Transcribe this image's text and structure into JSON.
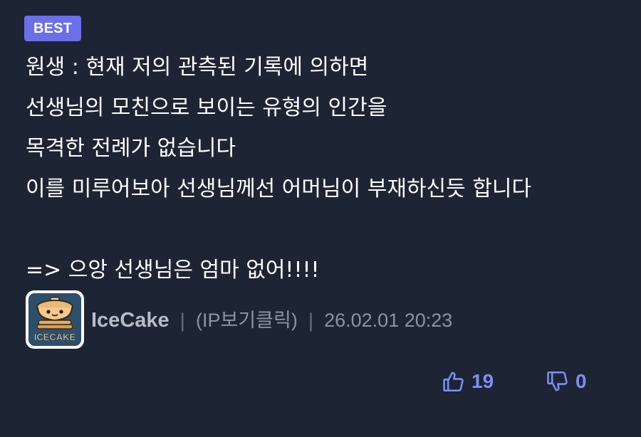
{
  "badge": {
    "label": "BEST"
  },
  "comment": {
    "lines": [
      "원생 : 현재 저의 관측된 기록에 의하면",
      "선생님의 모친으로 보이는 유형의 인간을",
      "목격한 전례가 없습니다",
      "이를 미루어보아 선생님께선 어머님이 부재하신듯 합니다",
      "",
      "=> 으앙 선생님은 엄마 없어!!!!"
    ]
  },
  "author": {
    "avatar_icon": "icecake-avatar-icon",
    "avatar_text": "ICECAKE",
    "name": "IceCake",
    "separator": "|",
    "ip_label": "(IP보기클릭)",
    "datetime": "26.02.01 20:23"
  },
  "votes": {
    "up_icon": "thumbs-up-icon",
    "up_count": "19",
    "down_icon": "thumbs-down-icon",
    "down_count": "0",
    "accent_color": "#7d8ef4"
  },
  "colors": {
    "background": "#1d2433",
    "badge": "#6b6fe8"
  }
}
